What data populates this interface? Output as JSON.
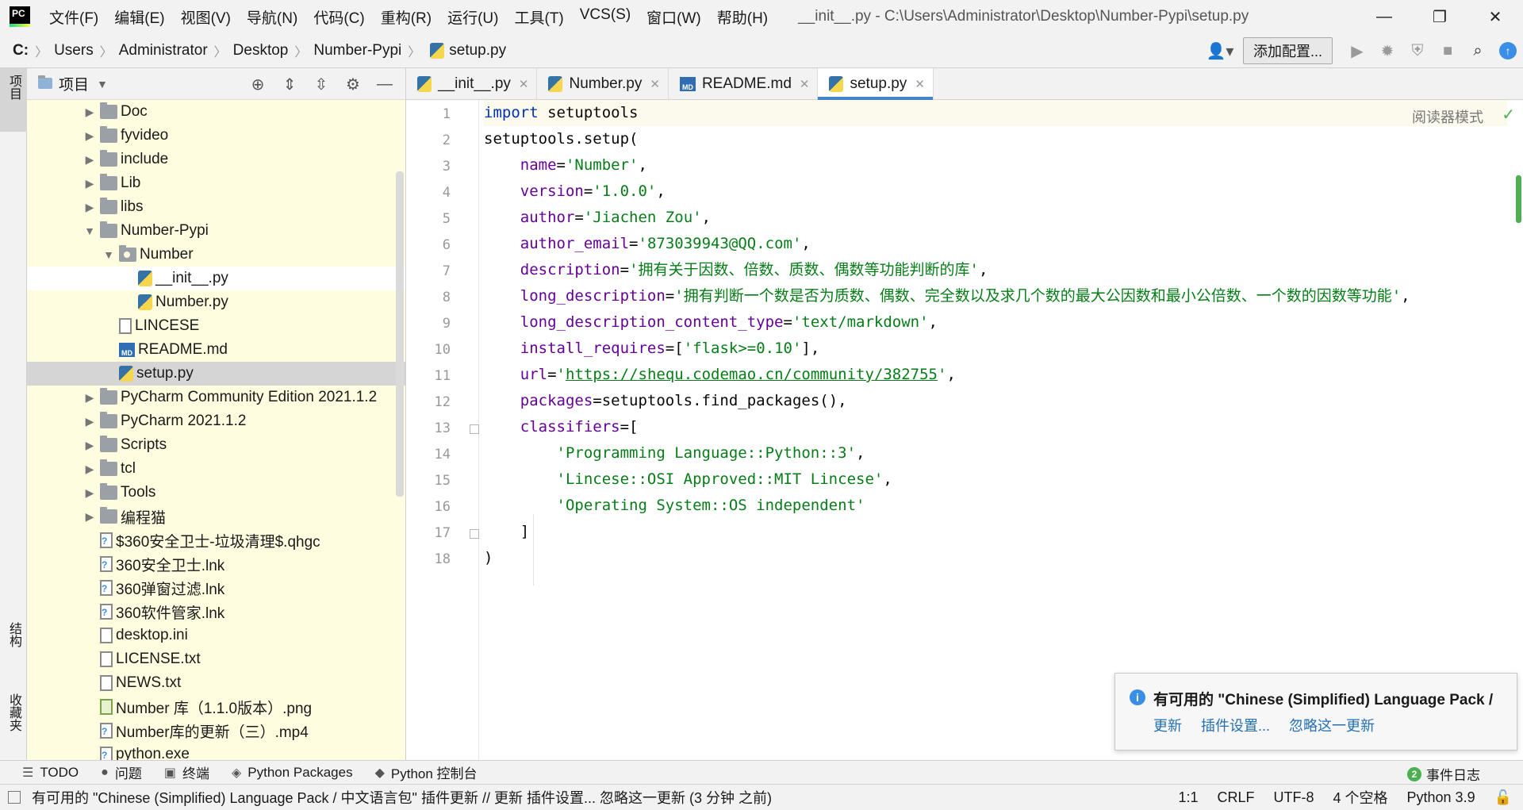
{
  "menu": [
    "文件(F)",
    "编辑(E)",
    "视图(V)",
    "导航(N)",
    "代码(C)",
    "重构(R)",
    "运行(U)",
    "工具(T)",
    "VCS(S)",
    "窗口(W)",
    "帮助(H)"
  ],
  "window_title": "__init__.py - C:\\Users\\Administrator\\Desktop\\Number-Pypi\\setup.py",
  "breadcrumbs": [
    "C:",
    "Users",
    "Administrator",
    "Desktop",
    "Number-Pypi",
    "setup.py"
  ],
  "add_config_label": "添加配置...",
  "left_strip": {
    "project": "项目",
    "structure": "结构",
    "favorites": "收藏夹"
  },
  "project_panel": {
    "title": "项目"
  },
  "tree": [
    {
      "label": "Doc",
      "type": "folder",
      "indent": 0,
      "expand": "closed"
    },
    {
      "label": "fyvideo",
      "type": "folder",
      "indent": 0,
      "expand": "closed"
    },
    {
      "label": "include",
      "type": "folder",
      "indent": 0,
      "expand": "closed"
    },
    {
      "label": "Lib",
      "type": "folder",
      "indent": 0,
      "expand": "closed"
    },
    {
      "label": "libs",
      "type": "folder",
      "indent": 0,
      "expand": "closed"
    },
    {
      "label": "Number-Pypi",
      "type": "folder",
      "indent": 0,
      "expand": "open"
    },
    {
      "label": "Number",
      "type": "pkg",
      "indent": 1,
      "expand": "open"
    },
    {
      "label": "__init__.py",
      "type": "py",
      "indent": 2,
      "expand": "none",
      "state": "white"
    },
    {
      "label": "Number.py",
      "type": "py",
      "indent": 2,
      "expand": "none"
    },
    {
      "label": "LINCESE",
      "type": "txt",
      "indent": 1,
      "expand": "none"
    },
    {
      "label": "README.md",
      "type": "md",
      "indent": 1,
      "expand": "none"
    },
    {
      "label": "setup.py",
      "type": "py",
      "indent": 1,
      "expand": "none",
      "state": "selected"
    },
    {
      "label": "PyCharm Community Edition 2021.1.2",
      "type": "folder",
      "indent": 0,
      "expand": "closed"
    },
    {
      "label": "PyCharm 2021.1.2",
      "type": "folder",
      "indent": 0,
      "expand": "closed"
    },
    {
      "label": "Scripts",
      "type": "folder",
      "indent": 0,
      "expand": "closed"
    },
    {
      "label": "tcl",
      "type": "folder",
      "indent": 0,
      "expand": "closed"
    },
    {
      "label": "Tools",
      "type": "folder",
      "indent": 0,
      "expand": "closed"
    },
    {
      "label": "编程猫",
      "type": "folder",
      "indent": 0,
      "expand": "closed"
    },
    {
      "label": "$360安全卫士-垃圾清理$.qhgc",
      "type": "unk",
      "indent": 0,
      "expand": "none"
    },
    {
      "label": "360安全卫士.lnk",
      "type": "unk",
      "indent": 0,
      "expand": "none"
    },
    {
      "label": "360弹窗过滤.lnk",
      "type": "unk",
      "indent": 0,
      "expand": "none"
    },
    {
      "label": "360软件管家.lnk",
      "type": "unk",
      "indent": 0,
      "expand": "none"
    },
    {
      "label": "desktop.ini",
      "type": "txt",
      "indent": 0,
      "expand": "none"
    },
    {
      "label": "LICENSE.txt",
      "type": "txt",
      "indent": 0,
      "expand": "none"
    },
    {
      "label": "NEWS.txt",
      "type": "txt",
      "indent": 0,
      "expand": "none"
    },
    {
      "label": "Number 库（1.1.0版本）.png",
      "type": "png",
      "indent": 0,
      "expand": "none"
    },
    {
      "label": "Number库的更新（三）.mp4",
      "type": "unk",
      "indent": 0,
      "expand": "none"
    },
    {
      "label": "python.exe",
      "type": "unk",
      "indent": 0,
      "expand": "none"
    }
  ],
  "tabs": [
    {
      "label": "__init__.py",
      "type": "py",
      "active": false
    },
    {
      "label": "Number.py",
      "type": "py",
      "active": false
    },
    {
      "label": "README.md",
      "type": "md",
      "active": false
    },
    {
      "label": "setup.py",
      "type": "py",
      "active": true
    }
  ],
  "reader_mode": "阅读器模式",
  "code_lines": [
    [
      {
        "t": "import",
        "c": "kw"
      },
      {
        "t": " setuptools",
        "c": ""
      }
    ],
    [
      {
        "t": "setuptools.setup(",
        "c": ""
      }
    ],
    [
      {
        "t": "    ",
        "c": ""
      },
      {
        "t": "name",
        "c": "param"
      },
      {
        "t": "=",
        "c": ""
      },
      {
        "t": "'Number'",
        "c": "str"
      },
      {
        "t": ",",
        "c": ""
      }
    ],
    [
      {
        "t": "    ",
        "c": ""
      },
      {
        "t": "version",
        "c": "param"
      },
      {
        "t": "=",
        "c": ""
      },
      {
        "t": "'1.0.0'",
        "c": "str"
      },
      {
        "t": ",",
        "c": ""
      }
    ],
    [
      {
        "t": "    ",
        "c": ""
      },
      {
        "t": "author",
        "c": "param"
      },
      {
        "t": "=",
        "c": ""
      },
      {
        "t": "'Jiachen Zou'",
        "c": "str"
      },
      {
        "t": ",",
        "c": ""
      }
    ],
    [
      {
        "t": "    ",
        "c": ""
      },
      {
        "t": "author_email",
        "c": "param"
      },
      {
        "t": "=",
        "c": ""
      },
      {
        "t": "'873039943@QQ.com'",
        "c": "str"
      },
      {
        "t": ",",
        "c": ""
      }
    ],
    [
      {
        "t": "    ",
        "c": ""
      },
      {
        "t": "description",
        "c": "param"
      },
      {
        "t": "=",
        "c": ""
      },
      {
        "t": "'拥有关于因数、倍数、质数、偶数等功能判断的库'",
        "c": "str"
      },
      {
        "t": ",",
        "c": ""
      }
    ],
    [
      {
        "t": "    ",
        "c": ""
      },
      {
        "t": "long_description",
        "c": "param"
      },
      {
        "t": "=",
        "c": ""
      },
      {
        "t": "'拥有判断一个数是否为质数、偶数、完全数以及求几个数的最大公因数和最小公倍数、一个数的因数等功能'",
        "c": "str"
      },
      {
        "t": ",",
        "c": ""
      }
    ],
    [
      {
        "t": "    ",
        "c": ""
      },
      {
        "t": "long_description_content_type",
        "c": "param"
      },
      {
        "t": "=",
        "c": ""
      },
      {
        "t": "'text/markdown'",
        "c": "str"
      },
      {
        "t": ",",
        "c": ""
      }
    ],
    [
      {
        "t": "    ",
        "c": ""
      },
      {
        "t": "install_requires",
        "c": "param"
      },
      {
        "t": "=[",
        "c": ""
      },
      {
        "t": "'flask>=0.10'",
        "c": "str"
      },
      {
        "t": "],",
        "c": ""
      }
    ],
    [
      {
        "t": "    ",
        "c": ""
      },
      {
        "t": "url",
        "c": "param"
      },
      {
        "t": "=",
        "c": ""
      },
      {
        "t": "'",
        "c": "str"
      },
      {
        "t": "https://shequ.codemao.cn/community/382755",
        "c": "link"
      },
      {
        "t": "'",
        "c": "str"
      },
      {
        "t": ",",
        "c": ""
      }
    ],
    [
      {
        "t": "    ",
        "c": ""
      },
      {
        "t": "packages",
        "c": "param"
      },
      {
        "t": "=setuptools.find_packages(),",
        "c": ""
      }
    ],
    [
      {
        "t": "    ",
        "c": ""
      },
      {
        "t": "classifiers",
        "c": "param"
      },
      {
        "t": "=[",
        "c": ""
      }
    ],
    [
      {
        "t": "        ",
        "c": ""
      },
      {
        "t": "'Programming Language::Python::3'",
        "c": "str"
      },
      {
        "t": ",",
        "c": ""
      }
    ],
    [
      {
        "t": "        ",
        "c": ""
      },
      {
        "t": "'Lincese::OSI Approved::MIT Lincese'",
        "c": "str"
      },
      {
        "t": ",",
        "c": ""
      }
    ],
    [
      {
        "t": "        ",
        "c": ""
      },
      {
        "t": "'Operating System::OS independent'",
        "c": "str"
      }
    ],
    [
      {
        "t": "    ]",
        "c": ""
      }
    ],
    [
      {
        "t": ")",
        "c": ""
      }
    ]
  ],
  "notification": {
    "title": "有可用的 \"Chinese (Simplified) Language Pack /",
    "links": [
      "更新",
      "插件设置...",
      "忽略这一更新"
    ]
  },
  "tool_windows": [
    {
      "label": "TODO",
      "icon": "list-icon",
      "glyph": "☰"
    },
    {
      "label": "问题",
      "icon": "problems-icon",
      "glyph": "●"
    },
    {
      "label": "终端",
      "icon": "terminal-icon",
      "glyph": "▣"
    },
    {
      "label": "Python Packages",
      "icon": "packages-icon",
      "glyph": "◈"
    },
    {
      "label": "Python 控制台",
      "icon": "console-icon",
      "glyph": "◆"
    }
  ],
  "event_log": {
    "count": "2",
    "label": "事件日志"
  },
  "status": {
    "message": "有可用的 \"Chinese (Simplified) Language Pack / 中文语言包\" 插件更新 // 更新   插件设置...   忽略这一更新 (3 分钟 之前)",
    "position": "1:1",
    "line_ending": "CRLF",
    "encoding": "UTF-8",
    "indent": "4 个空格",
    "interpreter": "Python 3.9"
  }
}
